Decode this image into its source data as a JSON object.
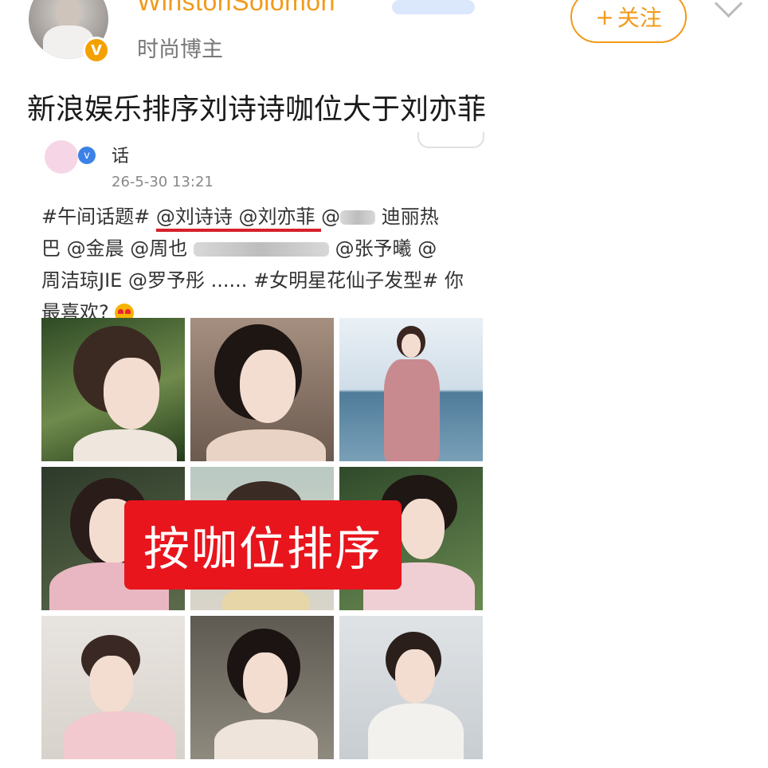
{
  "header": {
    "username": "WinstonSolomon",
    "user_tag": "时尚博主",
    "follow_plus": "+",
    "follow_label": "关注"
  },
  "post": {
    "text": "新浪娱乐排序刘诗诗咖位大于刘亦菲"
  },
  "embedded": {
    "author_name": "话",
    "timestamp": "26-5-30 13:21",
    "text_line1_a": "#午间话题#",
    "mention1": "@刘诗诗",
    "mention2": "@刘亦菲",
    "text_line1_b": "@",
    "text_line1_c": "迪丽热",
    "text_line2_a": "巴",
    "text_line2_b": "@金晨",
    "text_line2_c": "@周也",
    "text_line2_d": "@张予曦",
    "text_line2_e": "@",
    "text_line3_a": "周洁琼JIE",
    "text_line3_b": "@罗予彤",
    "text_line3_c": "......",
    "text_line3_d": "#女明星花仙子发型#",
    "text_line3_e": "你",
    "text_line4": "最喜欢?",
    "banner": "按咖位排序",
    "colors": {
      "username": "#f29a1a",
      "follow": "#f29a1a",
      "verified_badge": "#f4a100",
      "mention_underline": "#d6202a",
      "banner": "#e8151d"
    },
    "icons": [
      "verified-v-icon",
      "chevron-down-icon",
      "blue-verified-icon",
      "heart-eyes-emoji-icon"
    ]
  }
}
